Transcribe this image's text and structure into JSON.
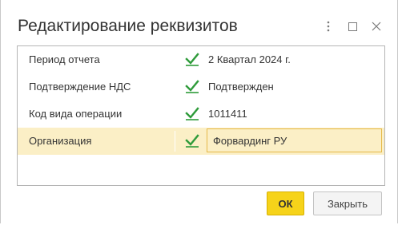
{
  "dialog": {
    "title": "Редактирование реквизитов"
  },
  "title_bar": {
    "more_icon": "vertical-ellipsis",
    "maximize_icon": "square",
    "close_icon": "x"
  },
  "attributes": [
    {
      "name": "Период отчета",
      "checked": true,
      "value": "2 Квартал 2024 г."
    },
    {
      "name": "Подтверждение НДС",
      "checked": true,
      "value": "Подтвержден"
    },
    {
      "name": "Код вида операции",
      "checked": true,
      "value": "1011411"
    },
    {
      "name": "Организация",
      "checked": true,
      "value": "Форвардинг РУ",
      "selected": true
    }
  ],
  "buttons": {
    "ok_label": "ОК",
    "close_label": "Закрыть"
  },
  "colors": {
    "check": "#2e9b3a",
    "selected_row": "#fbefc6",
    "ok_button": "#f6d31a"
  }
}
